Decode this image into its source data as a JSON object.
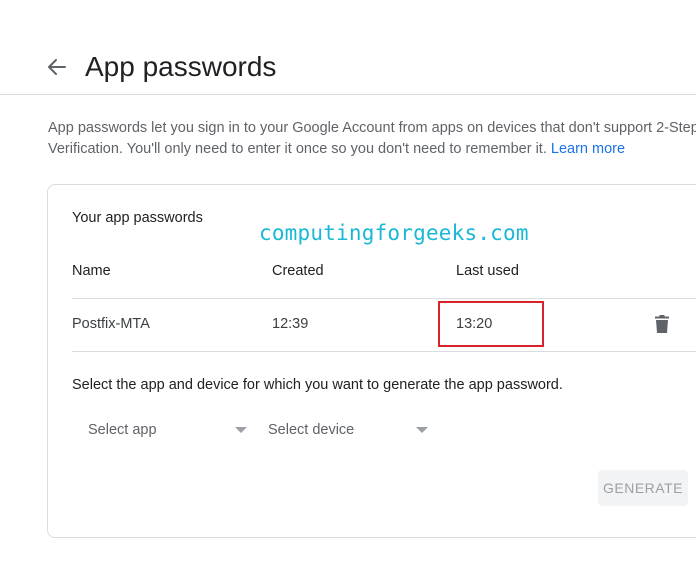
{
  "header": {
    "back_icon": "arrow-left-icon",
    "title": "App passwords"
  },
  "intro": {
    "line1": "App passwords let you sign in to your Google Account from apps on devices that don't support 2-Step",
    "line2": "Verification. You'll only need to enter it once so you don't need to remember it. ",
    "learn_more": "Learn more"
  },
  "card": {
    "section_title": "Your app passwords",
    "watermark": "computingforgeeks.com",
    "columns": {
      "name": "Name",
      "created": "Created",
      "last_used": "Last used"
    },
    "rows": [
      {
        "name": "Postfix-MTA",
        "created": "12:39",
        "last_used": "13:20",
        "delete_icon": "trash-icon"
      }
    ],
    "generate_prompt": "Select the app and device for which you want to generate the app password.",
    "select_app": {
      "label": "Select app",
      "icon": "dropdown-caret-icon"
    },
    "select_device": {
      "label": "Select device",
      "icon": "dropdown-caret-icon"
    },
    "generate_button": "GENERATE"
  },
  "colors": {
    "link": "#1a73e8",
    "watermark": "#19b8d6",
    "highlight": "#d9232b",
    "disabled_button_bg": "#f1f3f4",
    "disabled_button_text": "#9aa0a6"
  }
}
